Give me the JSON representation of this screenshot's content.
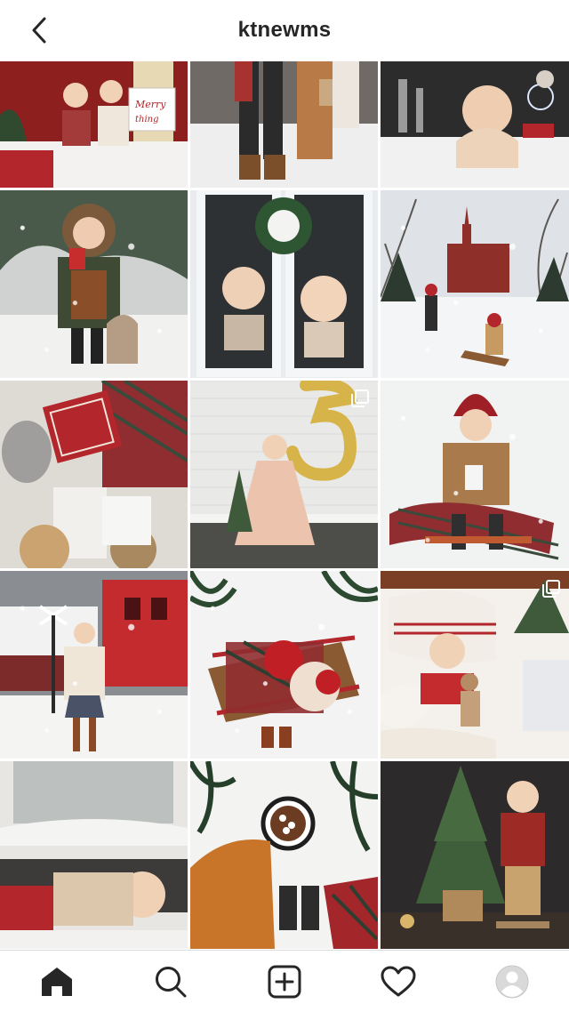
{
  "header": {
    "username": "ktnewms",
    "back_icon": "chevron-left-icon"
  },
  "grid": {
    "tiles": [
      {
        "name": "post-1",
        "scene": "kids-red-barn-merry-sign",
        "multi": false
      },
      {
        "name": "post-2",
        "scene": "family-legs-gifts-snow",
        "multi": false
      },
      {
        "name": "post-3",
        "scene": "baby-bath-bubbles",
        "multi": false
      },
      {
        "name": "post-4",
        "scene": "girl-fur-hood-cocoa",
        "multi": false
      },
      {
        "name": "post-5",
        "scene": "kids-frosty-window-wreath",
        "multi": false
      },
      {
        "name": "post-6",
        "scene": "church-sled-snow",
        "multi": false
      },
      {
        "name": "post-7",
        "scene": "kids-lying-blanket-books",
        "multi": false
      },
      {
        "name": "post-8",
        "scene": "girl-number-5-balloon",
        "multi": true
      },
      {
        "name": "post-9",
        "scene": "toddler-sled-red-hat",
        "multi": false
      },
      {
        "name": "post-10",
        "scene": "girl-train-station",
        "multi": false
      },
      {
        "name": "post-11",
        "scene": "kids-sled-overhead",
        "multi": false
      },
      {
        "name": "post-12",
        "scene": "toddler-bed-teddy",
        "multi": true
      },
      {
        "name": "post-13",
        "scene": "kids-in-car-rear-window",
        "multi": false
      },
      {
        "name": "post-14",
        "scene": "cocoa-mug-feet-overhead",
        "multi": false
      },
      {
        "name": "post-15",
        "scene": "boy-christmas-tree",
        "multi": false
      }
    ],
    "multi_icon": "multiple-photos-icon"
  },
  "tabbar": {
    "items": [
      {
        "name": "home",
        "icon": "home-icon",
        "active": true
      },
      {
        "name": "search",
        "icon": "search-icon",
        "active": false
      },
      {
        "name": "new-post",
        "icon": "plus-square-icon",
        "active": false
      },
      {
        "name": "activity",
        "icon": "heart-icon",
        "active": false
      },
      {
        "name": "profile",
        "icon": "avatar-icon",
        "active": false
      }
    ]
  },
  "colors": {
    "text": "#262626",
    "divider": "#dbdbdb",
    "background": "#ffffff",
    "accent_red": "#b3262b"
  }
}
